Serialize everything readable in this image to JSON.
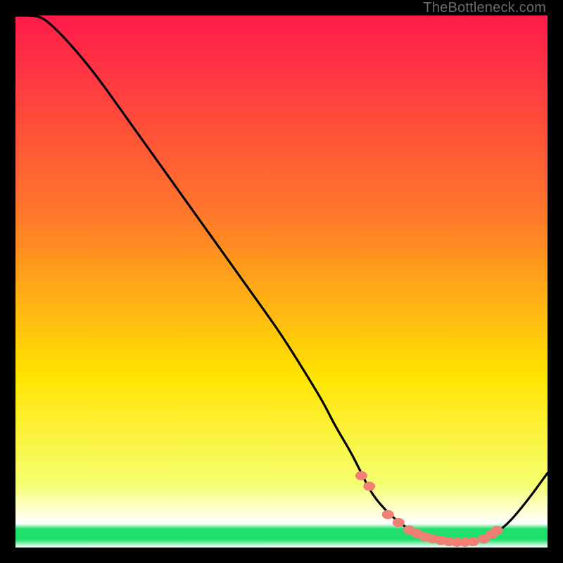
{
  "watermark": "TheBottleneck.com",
  "colors": {
    "gradient_top": "#ff1b4b",
    "gradient_mid1": "#ff7a2a",
    "gradient_mid2": "#ffe400",
    "gradient_bot1": "#f6ff70",
    "gradient_bot2": "#ffffff",
    "green_band": "#1fe06a",
    "curve": "#000000",
    "marker_fill": "#f08074",
    "marker_stroke": "#b84d40"
  },
  "chart_data": {
    "type": "line",
    "title": "",
    "xlabel": "",
    "ylabel": "",
    "xlim": [
      0,
      100
    ],
    "ylim": [
      0,
      100
    ],
    "series": [
      {
        "name": "bottleneck-curve",
        "x": [
          0,
          4,
          6,
          10,
          15,
          20,
          25,
          30,
          35,
          40,
          45,
          50,
          55,
          58,
          60,
          63,
          65,
          67,
          70,
          73,
          76,
          80,
          83,
          85,
          88,
          92,
          96,
          100
        ],
        "y": [
          100,
          100,
          99,
          95,
          89,
          82,
          75,
          68,
          61,
          54,
          47,
          40,
          32,
          27,
          23,
          18,
          14,
          10,
          6.5,
          4,
          2.3,
          1.3,
          1.0,
          1.0,
          1.4,
          3.8,
          8.5,
          14
        ]
      }
    ],
    "markers": {
      "name": "highlight-points",
      "x": [
        65,
        66.5,
        70,
        72,
        74,
        75.5,
        77,
        78.5,
        80,
        81.5,
        83,
        84.5,
        86,
        88,
        89.5,
        90.5
      ],
      "y": [
        13.5,
        11.5,
        6.2,
        4.7,
        3.3,
        2.6,
        2.0,
        1.6,
        1.3,
        1.1,
        1.0,
        1.0,
        1.1,
        1.6,
        2.5,
        3.2
      ]
    }
  }
}
